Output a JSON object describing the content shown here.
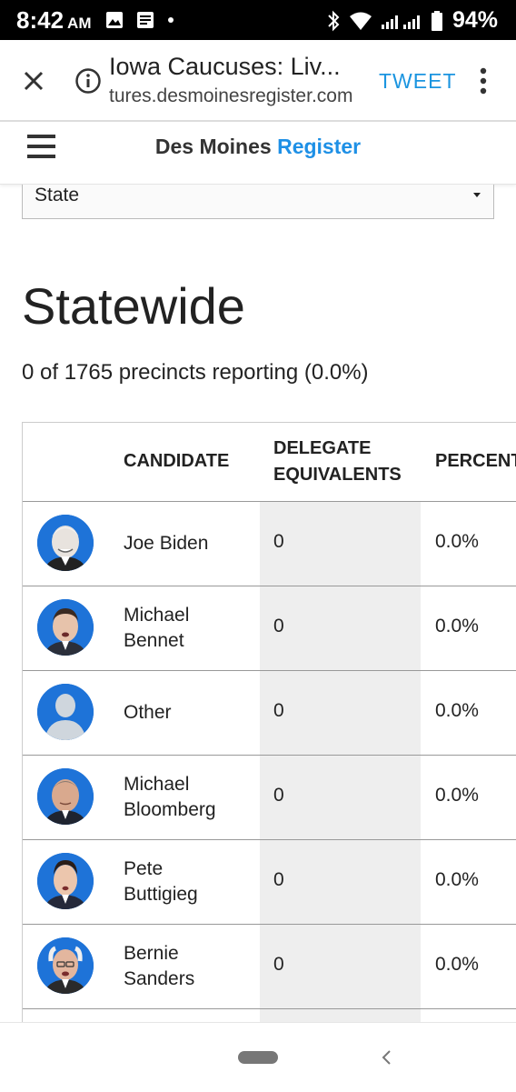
{
  "status": {
    "time": "8:42",
    "ampm": "AM",
    "battery": "94%"
  },
  "browser": {
    "title": "Iowa Caucuses: Liv...",
    "url": "tures.desmoinesregister.com",
    "tweet_label": "TWEET"
  },
  "site": {
    "logo_part1": "Des Moines ",
    "logo_part2": "Register",
    "brand_color": "#1e90e6"
  },
  "filter": {
    "selected": "State"
  },
  "main": {
    "title": "Statewide",
    "precincts": "0 of 1765 precincts reporting (0.0%)"
  },
  "table": {
    "headers": {
      "candidate": "CANDIDATE",
      "delegates_line1": "DELEGATE",
      "delegates_line2": "EQUIVALENTS",
      "percent": "PERCENT"
    },
    "rows": [
      {
        "name": "Joe Biden",
        "delegates": "0",
        "percent": "0.0%",
        "avatar": "biden-photo"
      },
      {
        "name": "Michael Bennet",
        "delegates": "0",
        "percent": "0.0%",
        "avatar": "bennet-photo"
      },
      {
        "name": "Other",
        "delegates": "0",
        "percent": "0.0%",
        "avatar": "placeholder-person-icon"
      },
      {
        "name": "Michael Bloomberg",
        "delegates": "0",
        "percent": "0.0%",
        "avatar": "bloomberg-photo"
      },
      {
        "name": "Pete Buttigieg",
        "delegates": "0",
        "percent": "0.0%",
        "avatar": "buttigieg-photo"
      },
      {
        "name": "Bernie Sanders",
        "delegates": "0",
        "percent": "0.0%",
        "avatar": "sanders-photo"
      }
    ]
  }
}
